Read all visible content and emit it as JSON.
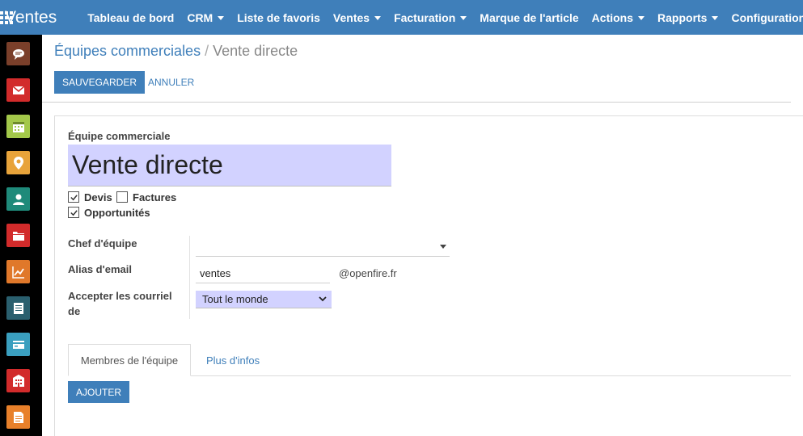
{
  "app": {
    "title": "Ventes"
  },
  "nav": {
    "items": [
      {
        "label": "Tableau de bord",
        "dropdown": false
      },
      {
        "label": "CRM",
        "dropdown": true
      },
      {
        "label": "Liste de favoris",
        "dropdown": false
      },
      {
        "label": "Ventes",
        "dropdown": true
      },
      {
        "label": "Facturation",
        "dropdown": true
      },
      {
        "label": "Marque de l'article",
        "dropdown": false
      },
      {
        "label": "Actions",
        "dropdown": true
      },
      {
        "label": "Rapports",
        "dropdown": true
      },
      {
        "label": "Configuration",
        "dropdown": true
      }
    ]
  },
  "sidebar": {
    "items": [
      {
        "icon": "chat-icon",
        "color": "#7a3f2a"
      },
      {
        "icon": "mail-icon",
        "color": "#d22b2b"
      },
      {
        "icon": "calendar-icon",
        "color": "#a3c84a"
      },
      {
        "icon": "map-pin-icon",
        "color": "#e8a33a"
      },
      {
        "icon": "contact-icon",
        "color": "#1f8a7a"
      },
      {
        "icon": "folder-icon",
        "color": "#d22b2b"
      },
      {
        "icon": "chart-icon",
        "color": "#e0782a"
      },
      {
        "icon": "document-list-icon",
        "color": "#2a5f6e"
      },
      {
        "icon": "credit-card-icon",
        "color": "#3a9fbf"
      },
      {
        "icon": "building-icon",
        "color": "#d22b2b"
      },
      {
        "icon": "notes-icon",
        "color": "#e8802a"
      }
    ]
  },
  "breadcrumb": {
    "parent": "Équipes commerciales",
    "separator": "/",
    "current": "Vente directe"
  },
  "actions": {
    "save": "SAUVEGARDER",
    "discard": "ANNULER"
  },
  "form": {
    "team_label": "Équipe commerciale",
    "team_name": "Vente directe",
    "checkboxes": {
      "quotations": {
        "label": "Devis",
        "checked": true
      },
      "invoices": {
        "label": "Factures",
        "checked": false
      },
      "opportunities": {
        "label": "Opportunités",
        "checked": true
      }
    },
    "leader_label": "Chef d'équipe",
    "leader_value": "",
    "alias_label": "Alias d'email",
    "alias_value": "ventes",
    "alias_domain": "@openfire.fr",
    "accept_label": "Accepter les courriel de",
    "accept_value": "Tout le monde"
  },
  "tabs": [
    {
      "label": "Membres de l'équipe",
      "active": true
    },
    {
      "label": "Plus d'infos",
      "active": false
    }
  ],
  "members": {
    "add_button": "AJOUTER"
  },
  "colors": {
    "brand": "#3f7fba",
    "required_field": "#d2d2ff"
  }
}
